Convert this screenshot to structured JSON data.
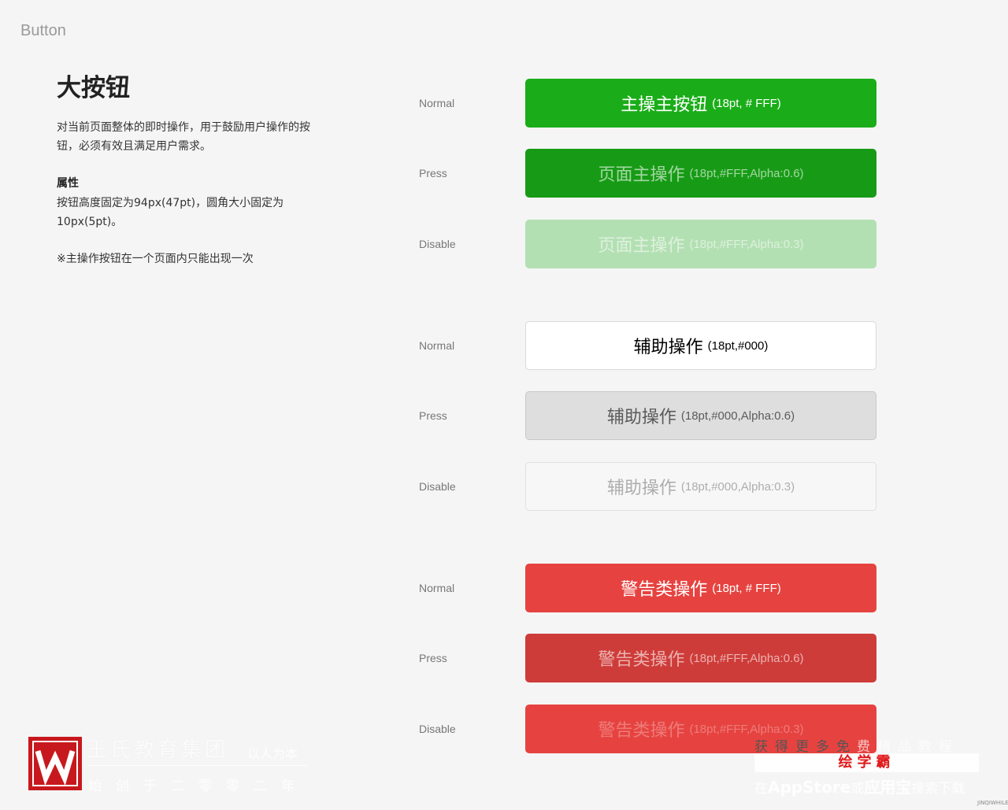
{
  "page": {
    "section": "Button",
    "title": "大按钮",
    "description": "对当前页面整体的即时操作，用于鼓励用户操作的按钮，必须有效且满足用户需求。",
    "property_title": "属性",
    "property_desc": "按钮高度固定为94px(47pt)，圆角大小固定为10px(5pt)。",
    "note": "※主操作按钮在一个页面内只能出现一次"
  },
  "groups": [
    {
      "rows": [
        {
          "state": "Normal",
          "label": "主操主按钮",
          "spec": "(18pt, # FFF)"
        },
        {
          "state": "Press",
          "label": "页面主操作",
          "spec": "(18pt,#FFF,Alpha:0.6)"
        },
        {
          "state": "Disable",
          "label": "页面主操作",
          "spec": "(18pt,#FFF,Alpha:0.3)"
        }
      ]
    },
    {
      "rows": [
        {
          "state": "Normal",
          "label": "辅助操作",
          "spec": "(18pt,#000)"
        },
        {
          "state": "Press",
          "label": "辅助操作",
          "spec": "(18pt,#000,Alpha:0.6)"
        },
        {
          "state": "Disable",
          "label": "辅助操作",
          "spec": "(18pt,#000,Alpha:0.3)"
        }
      ]
    },
    {
      "rows": [
        {
          "state": "Normal",
          "label": "警告类操作",
          "spec": "(18pt, # FFF)"
        },
        {
          "state": "Press",
          "label": "警告类操作",
          "spec": "(18pt,#FFF,Alpha:0.6)"
        },
        {
          "state": "Disable",
          "label": "警告类操作",
          "spec": "(18pt,#FFF,Alpha:0.3)"
        }
      ]
    }
  ],
  "colors": {
    "primary": "#1aad19",
    "primary_press": "#179b16",
    "warning": "#e64340",
    "background": "#f5f5f5"
  },
  "watermark": {
    "logo_letter": "W",
    "name": "王氏教育集团",
    "slogan": "以人为本",
    "sub": "始创于二零零二年",
    "ad_top_dark": "获得更多免",
    "ad_top_light": "费精品教程",
    "ad_brand": "绘学霸",
    "ad_bottom_pre": "在",
    "ad_bottom_app": "AppStore",
    "ad_bottom_mid": "或",
    "ad_bottom_store": "应用宝",
    "ad_bottom_post": "搜索下载",
    "tiny": "JINQIWHILE"
  }
}
